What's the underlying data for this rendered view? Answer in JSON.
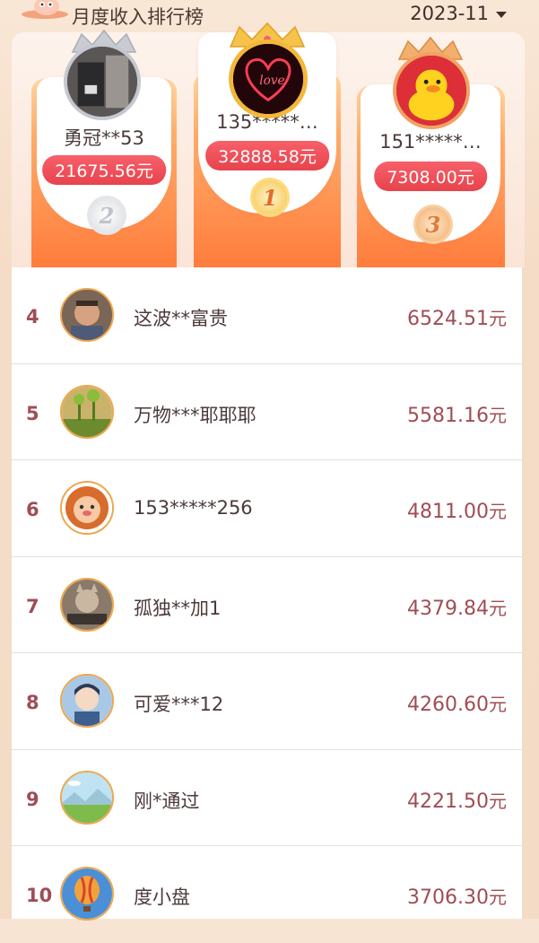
{
  "header": {
    "title": "月度收入排行榜",
    "period": "2023-11"
  },
  "podium": {
    "first": {
      "rank": "1",
      "name": "135*****…",
      "amount": "32888.58元",
      "avatar": "love-heart-avatar"
    },
    "second": {
      "rank": "2",
      "name": "勇冠**53",
      "amount": "21675.56元",
      "avatar": "photo-avatar"
    },
    "third": {
      "rank": "3",
      "name": "151*****…",
      "amount": "7308.00元",
      "avatar": "yellow-duck-avatar"
    }
  },
  "list": [
    {
      "rank": "4",
      "name": "这波**富贵",
      "amount": "6524.51",
      "unit": "元"
    },
    {
      "rank": "5",
      "name": "万物***耶耶耶",
      "amount": "5581.16",
      "unit": "元"
    },
    {
      "rank": "6",
      "name": "153*****256",
      "amount": "4811.00",
      "unit": "元"
    },
    {
      "rank": "7",
      "name": "孤独**加1",
      "amount": "4379.84",
      "unit": "元"
    },
    {
      "rank": "8",
      "name": "可爱***12",
      "amount": "4260.60",
      "unit": "元"
    },
    {
      "rank": "9",
      "name": "刚*通过",
      "amount": "4221.50",
      "unit": "元"
    },
    {
      "rank": "10",
      "name": "度小盘",
      "amount": "3706.30",
      "unit": "元"
    }
  ],
  "colors": {
    "accent": "#e8434c",
    "rank_text": "#a04d55",
    "avatar_border": "#efa64e"
  }
}
